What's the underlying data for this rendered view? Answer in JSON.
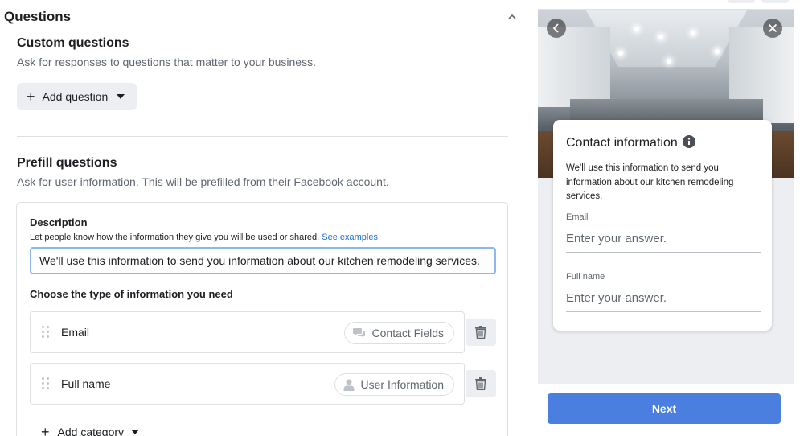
{
  "questions": {
    "title": "Questions",
    "custom": {
      "title": "Custom questions",
      "subtitle": "Ask for responses to questions that matter to your business.",
      "add_question_label": "Add question"
    },
    "prefill": {
      "title": "Prefill questions",
      "subtitle": "Ask for user information. This will be prefilled from their Facebook account.",
      "description_label": "Description",
      "description_help": "Let people know how the information they give you will be used or shared.",
      "see_examples_label": "See examples",
      "description_value": "We'll use this information to send you information about our kitchen remodeling services.",
      "choose_label": "Choose the type of information you need",
      "fields": [
        {
          "name": "Email",
          "category": "Contact Fields"
        },
        {
          "name": "Full name",
          "category": "User Information"
        }
      ],
      "add_category_label": "Add category"
    }
  },
  "preview": {
    "title": "Contact information",
    "text": "We'll use this information to send you information about our kitchen remodeling services.",
    "fields": [
      {
        "label": "Email",
        "placeholder": "Enter your answer."
      },
      {
        "label": "Full name",
        "placeholder": "Enter your answer."
      }
    ],
    "next_label": "Next"
  },
  "colors": {
    "accent": "#4a7fe0",
    "link": "#216fdb",
    "input_focus": "#8eb6ef"
  }
}
